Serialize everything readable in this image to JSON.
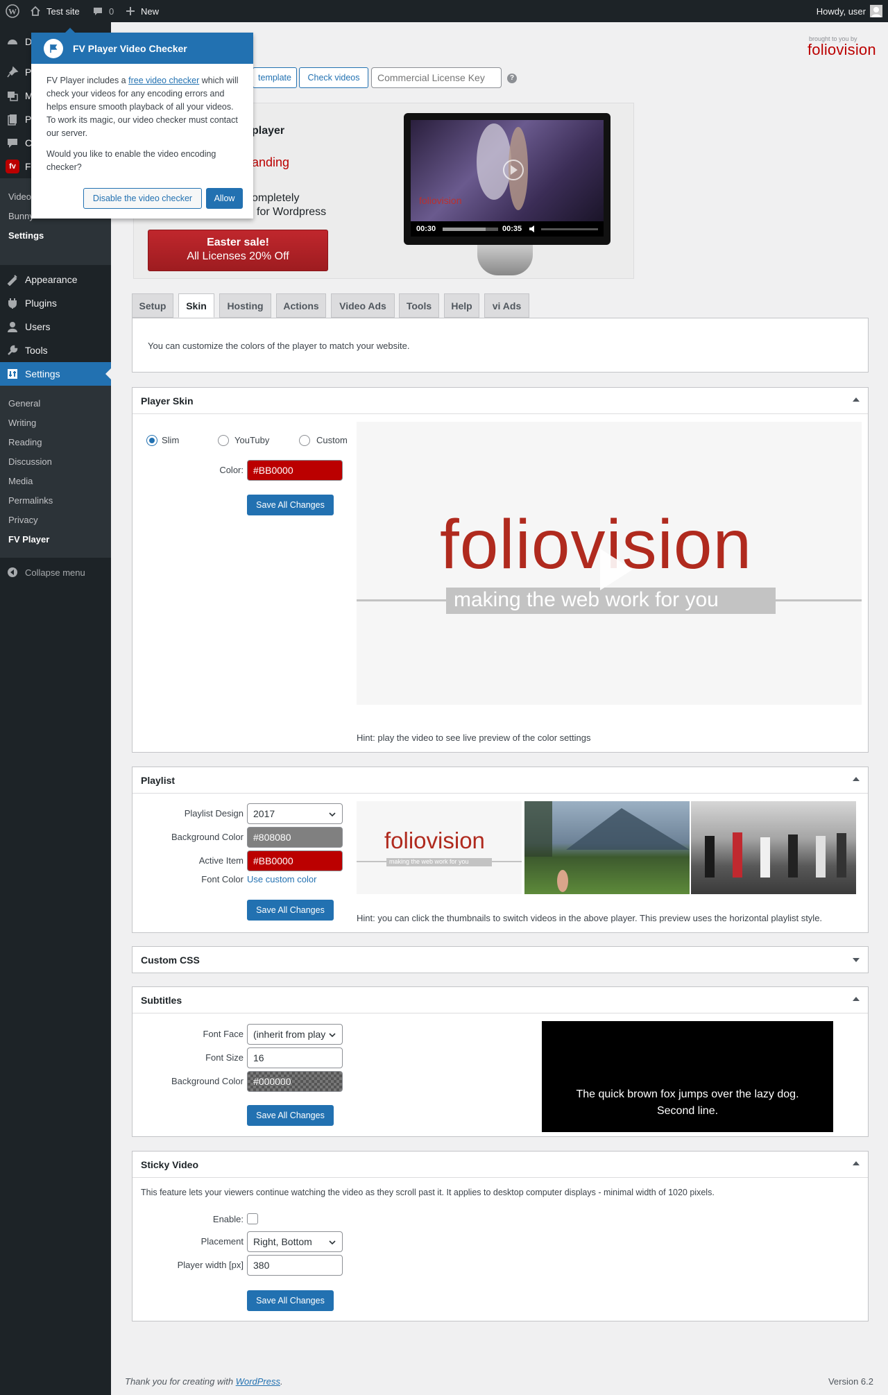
{
  "admin_bar": {
    "site_name": "Test site",
    "comments_count": "0",
    "new_label": "New",
    "howdy": "Howdy, user"
  },
  "sidebar": {
    "top_items": [
      {
        "label": "D",
        "icon": "dashboard-icon"
      },
      {
        "label": "P",
        "icon": "pin-icon"
      },
      {
        "label": "M",
        "icon": "media-icon"
      },
      {
        "label": "P",
        "icon": "pages-icon"
      },
      {
        "label": "C",
        "icon": "comments-icon"
      },
      {
        "label": "F",
        "icon": "fv-player-icon"
      }
    ],
    "fv_sub": [
      "Video",
      "Bunny",
      "Settings"
    ],
    "main_items": [
      {
        "label": "Appearance",
        "icon": "appearance-icon"
      },
      {
        "label": "Plugins",
        "icon": "plugins-icon"
      },
      {
        "label": "Users",
        "icon": "users-icon"
      },
      {
        "label": "Tools",
        "icon": "tools-icon"
      },
      {
        "label": "Settings",
        "icon": "settings-icon"
      }
    ],
    "settings_sub": [
      "General",
      "Writing",
      "Reading",
      "Discussion",
      "Media",
      "Permalinks",
      "Privacy",
      "FV Player"
    ],
    "collapse_label": "Collapse menu"
  },
  "popover": {
    "title": "FV Player Video Checker",
    "text_pre": "FV Player includes a ",
    "link_text": "free video checker",
    "text_post": " which will check your videos for any encoding errors and helps ensure smooth playback of all your videos. To work its magic, our video checker must contact our server.",
    "question": "Would you like to enable the video encoding checker?",
    "disable_label": "Disable the video checker",
    "allow_label": "Allow"
  },
  "header": {
    "brought_by": "brought to you by",
    "brand": "foliovision",
    "template_label": "template",
    "check_videos_label": "Check videos",
    "license_placeholder": "Commercial License Key",
    "help_mark": "?"
  },
  "promo": {
    "line1": "player",
    "line2": "anding",
    "line3": "ompletely",
    "line4": "for Wordpress",
    "sale_title": "Easter sale!",
    "sale_sub": "All Licenses 20% Off",
    "time_current": "00:30",
    "time_total": "00:35",
    "screen_brand": "foliovision"
  },
  "tabs": [
    "Setup",
    "Skin",
    "Hosting",
    "Actions",
    "Video Ads",
    "Tools",
    "Help",
    "vi Ads"
  ],
  "active_tab": "Skin",
  "intro": "You can customize the colors of the player to match your website.",
  "skin": {
    "title": "Player Skin",
    "options": [
      "Slim",
      "YouTuby",
      "Custom"
    ],
    "selected": "Slim",
    "color_label": "Color:",
    "color_value": "#BB0000",
    "save_label": "Save All Changes",
    "preview_brand": "foliovision",
    "preview_tagline": "making the web work for you",
    "hint": "Hint: play the video to see live preview of the color settings"
  },
  "playlist": {
    "title": "Playlist",
    "design_label": "Playlist Design",
    "design_value": "2017",
    "bg_label": "Background Color",
    "bg_value": "#808080",
    "active_label": "Active Item",
    "active_value": "#BB0000",
    "font_label": "Font Color",
    "font_link": "Use custom color",
    "save_label": "Save All Changes",
    "thumb_brand": "foliovision",
    "thumb_tagline": "making the web work for you",
    "hint": "Hint: you can click the thumbnails to switch videos in the above player. This preview uses the horizontal playlist style."
  },
  "custom_css": {
    "title": "Custom CSS"
  },
  "subtitles": {
    "title": "Subtitles",
    "face_label": "Font Face",
    "face_value": "(inherit from play",
    "size_label": "Font Size",
    "size_value": "16",
    "bg_label": "Background Color",
    "bg_value": "#000000",
    "save_label": "Save All Changes",
    "preview_line1": "The quick brown fox jumps over the lazy dog.",
    "preview_line2": "Second line."
  },
  "sticky": {
    "title": "Sticky Video",
    "desc": "This feature lets your viewers continue watching the video as they scroll past it. It applies to desktop computer displays - minimal width of 1020 pixels.",
    "enable_label": "Enable:",
    "placement_label": "Placement",
    "placement_value": "Right, Bottom",
    "width_label": "Player width [px]",
    "width_value": "380",
    "save_label": "Save All Changes"
  },
  "footer": {
    "thanks": "Thank you for creating with ",
    "wp_link": "WordPress",
    "dot": ".",
    "version": "Version 6.2"
  },
  "colors": {
    "accent": "#2271b1",
    "brand_red": "#BB0000",
    "sidebar_bg": "#1d2327",
    "playlist_bg": "#808080"
  }
}
